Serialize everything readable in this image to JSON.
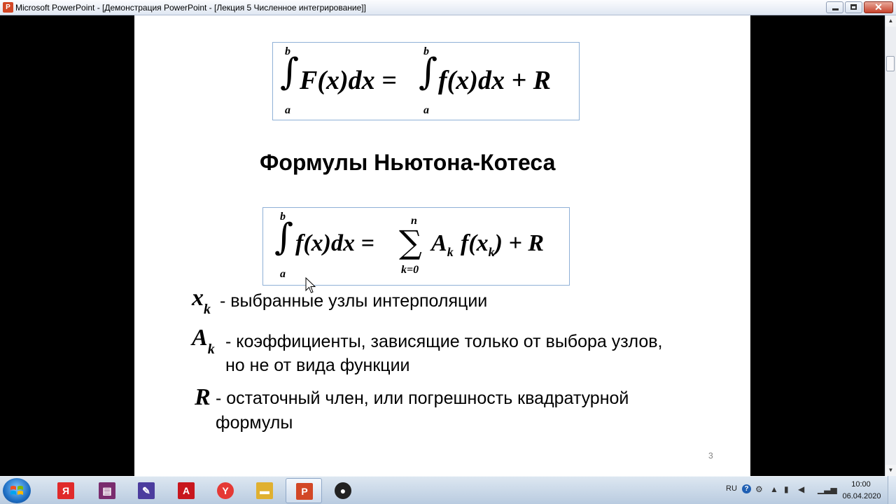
{
  "window": {
    "title": "Microsoft PowerPoint - [Демонстрация PowerPoint - [Лекция 5 Численное интегрирование]]"
  },
  "slide": {
    "heading": "Формулы Ньютона-Котеса",
    "formula1": {
      "lower_limit_left": "a",
      "upper_limit_left": "b",
      "lhs": "F(x)dx =",
      "lower_limit_right": "a",
      "upper_limit_right": "b",
      "rhs": "f(x)dx + R"
    },
    "formula2": {
      "lower_limit": "a",
      "upper_limit": "b",
      "lhs": "f(x)dx =",
      "sum_upper": "n",
      "sum_lower": "k=0",
      "rhs_A": "A",
      "rhs_A_sub": "k",
      "rhs_f": "f(x",
      "rhs_x_sub": "k",
      "rhs_tail": ") + R"
    },
    "definitions": [
      {
        "symbol": "x",
        "sub": "k",
        "line1": "- выбранные узлы интерполяции",
        "line2": ""
      },
      {
        "symbol": "A",
        "sub": "k",
        "line1": "- коэффициенты, зависящие только от выбора узлов,",
        "line2": "но не от вида функции"
      },
      {
        "symbol": "R",
        "sub": "",
        "line1": "- остаточный член, или погрешность квадратурной",
        "line2": "формулы"
      }
    ],
    "slide_number": "3"
  },
  "taskbar": {
    "items": [
      {
        "name": "yandex-browser",
        "glyph": "Я",
        "color": "#e02a2a"
      },
      {
        "name": "winrar",
        "glyph": "▤",
        "color": "#7a2c6e"
      },
      {
        "name": "notes-app",
        "glyph": "✎",
        "color": "#4b3c9e"
      },
      {
        "name": "acrobat-reader",
        "glyph": "A",
        "color": "#c8161d"
      },
      {
        "name": "yandex",
        "glyph": "Y",
        "color": "#e53935"
      },
      {
        "name": "file-explorer",
        "glyph": "▬",
        "color": "#e0b030"
      },
      {
        "name": "powerpoint",
        "glyph": "P",
        "color": "#d24726"
      },
      {
        "name": "obs-studio",
        "glyph": "●",
        "color": "#222222"
      }
    ],
    "language": "RU",
    "time": "10:00",
    "date": "06.04.2020"
  }
}
